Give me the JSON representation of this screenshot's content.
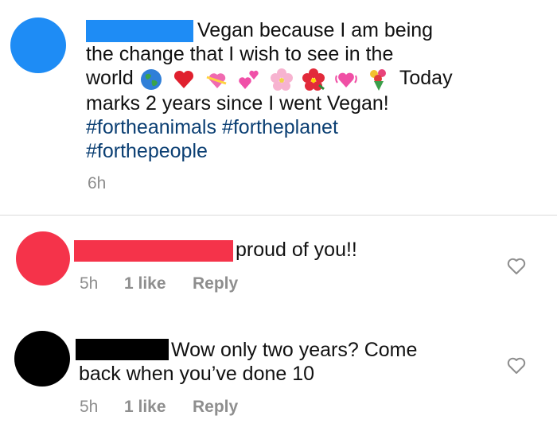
{
  "post": {
    "caption_line1": "Vegan because I am being",
    "caption_line2": "the change that I wish to see in the",
    "caption_line3_start": "world",
    "caption_line3_end": "Today",
    "caption_line4": "marks 2 years since I went Vegan!",
    "hashtag1": "#fortheanimals",
    "hashtag2": "#fortheplanet",
    "hashtag3": "#forthepeople",
    "time": "6h",
    "emojis": [
      "globe-emoji",
      "red-heart-emoji",
      "heart-with-ribbon-emoji",
      "two-hearts-emoji",
      "cherry-blossom-emoji",
      "hibiscus-emoji",
      "beating-heart-emoji",
      "bouquet-emoji"
    ],
    "avatar_color": "#1e8cf5",
    "redaction_color": "#1e8cf5"
  },
  "comments": [
    {
      "text_line1": "proud of you!!",
      "text_line2": "",
      "time": "5h",
      "likes": "1 like",
      "reply": "Reply",
      "avatar_color": "#f5334a",
      "redaction_color": "#f5334a"
    },
    {
      "text_line1": "Wow only two years? Come",
      "text_line2": "back when you’ve done 10",
      "time": "5h",
      "likes": "1 like",
      "reply": "Reply",
      "avatar_color": "#000000",
      "redaction_color": "#000000"
    }
  ]
}
